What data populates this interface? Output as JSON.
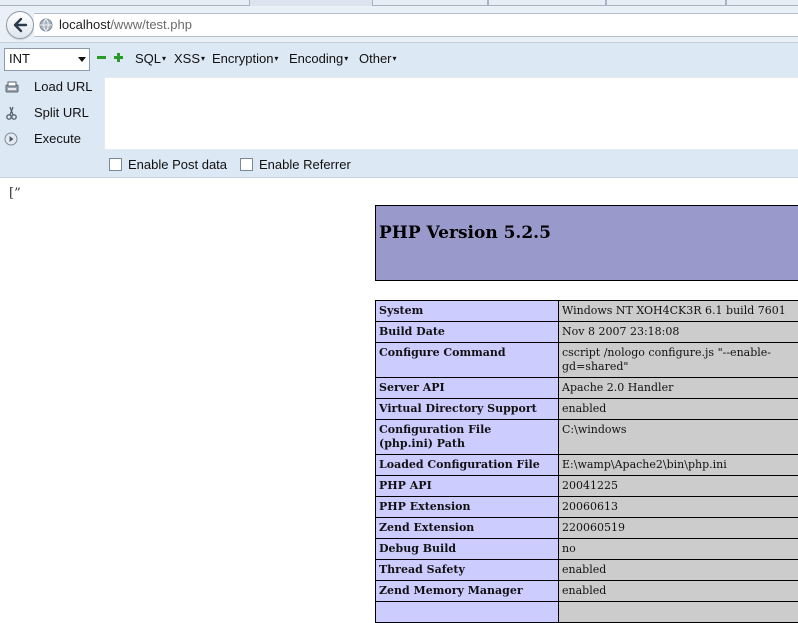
{
  "browser": {
    "url_host": "localhost",
    "url_path": "/www/test.php"
  },
  "hackbar": {
    "mode_select": "INT",
    "menu": [
      "SQL",
      "XSS",
      "Encryption",
      "Encoding",
      "Other"
    ],
    "side": [
      "Load URL",
      "Split URL",
      "Execute"
    ],
    "options": [
      "Enable Post data",
      "Enable Referrer"
    ],
    "colors": {
      "background": "#dde8f5"
    }
  },
  "page": {
    "junk_text": "[”",
    "php_title": "PHP Version 5.2.5",
    "rows": [
      {
        "k": "System",
        "v": [
          "Windows NT XOH4CK3R 6.1 build 7601"
        ]
      },
      {
        "k": "Build Date",
        "v": [
          "Nov 8 2007 23:18:08"
        ]
      },
      {
        "k": "Configure Command",
        "v": [
          "cscript /nologo configure.js \"--enable-",
          "gd=shared\""
        ]
      },
      {
        "k": "Server API",
        "v": [
          "Apache 2.0 Handler"
        ]
      },
      {
        "k": "Virtual Directory Support",
        "v": [
          "enabled"
        ]
      },
      {
        "k": [
          "Configuration File",
          "(php.ini) Path"
        ],
        "v": [
          "C:\\windows"
        ]
      },
      {
        "k": "Loaded Configuration File",
        "v": [
          "E:\\wamp\\Apache2\\bin\\php.ini"
        ]
      },
      {
        "k": "PHP API",
        "v": [
          "20041225"
        ]
      },
      {
        "k": "PHP Extension",
        "v": [
          "20060613"
        ]
      },
      {
        "k": "Zend Extension",
        "v": [
          "220060519"
        ]
      },
      {
        "k": "Debug Build",
        "v": [
          "no"
        ]
      },
      {
        "k": "Thread Safety",
        "v": [
          "enabled"
        ]
      },
      {
        "k": "Zend Memory Manager",
        "v": [
          "enabled"
        ]
      },
      {
        "k": "",
        "v": [
          ""
        ]
      }
    ],
    "colors": {
      "header": "#9999cc",
      "key": "#ccccff",
      "value": "#cccccc"
    }
  }
}
